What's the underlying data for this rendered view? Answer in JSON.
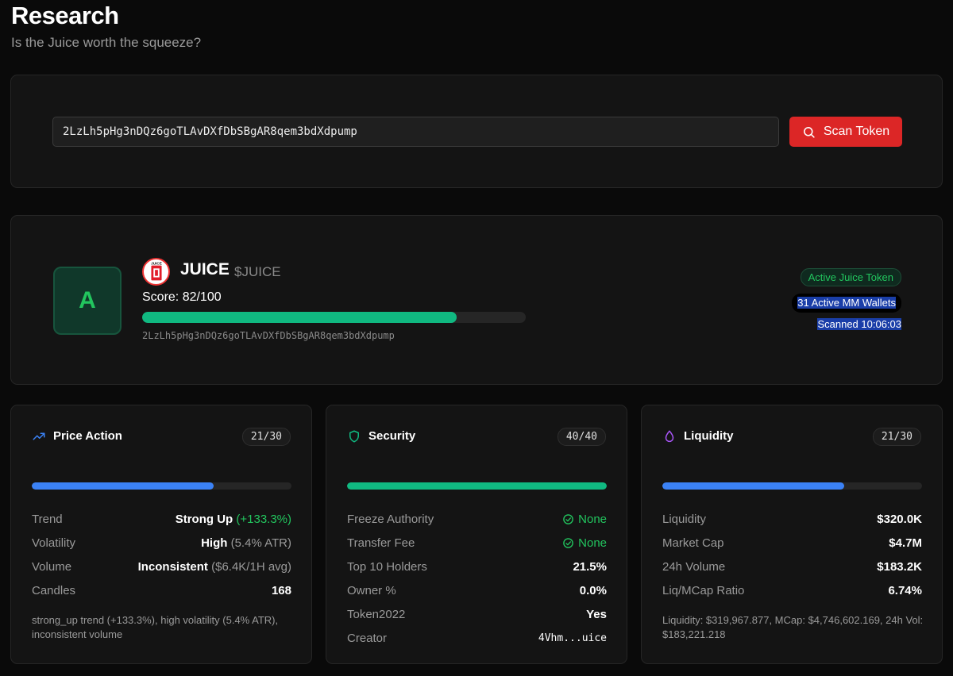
{
  "header": {
    "title": "Research",
    "subtitle": "Is the Juice worth the squeeze?"
  },
  "search": {
    "value": "2LzLh5pHg3nDQz6goTLAvDXfDbSBgAR8qem3bdXdpump",
    "button_label": "Scan Token",
    "button_icon": "search-icon",
    "button_color": "#dc2626"
  },
  "token": {
    "grade": "A",
    "name": "JUICE",
    "symbol": "$JUICE",
    "score_label": "Score: 82/100",
    "score": 82,
    "score_max": 100,
    "address": "2LzLh5pHg3nDQz6goTLAvDXfDbSBgAR8qem3bdXdpump",
    "logo_text": "JUICE",
    "badges": {
      "active": "Active Juice Token",
      "mm_wallets": "31 Active MM Wallets",
      "scanned": "Scanned 10:06:03"
    }
  },
  "price_action": {
    "title": "Price Action",
    "icon": "trending-up-icon",
    "score": "21/30",
    "fill": 0.7,
    "color": "#3b82f6",
    "rows": [
      {
        "label": "Trend",
        "value": "Strong Up",
        "detail": "(+133.3%)"
      },
      {
        "label": "Volatility",
        "value": "High",
        "detail": "(5.4% ATR)"
      },
      {
        "label": "Volume",
        "value": "Inconsistent",
        "detail": "($6.4K/1H avg)"
      },
      {
        "label": "Candles",
        "value": "168",
        "detail": ""
      }
    ],
    "note": "strong_up trend (+133.3%), high volatility (5.4% ATR), inconsistent volume"
  },
  "security": {
    "title": "Security",
    "icon": "shield-icon",
    "score": "40/40",
    "fill": 1.0,
    "color": "#10b981",
    "rows": [
      {
        "label": "Freeze Authority",
        "value": "None"
      },
      {
        "label": "Transfer Fee",
        "value": "None"
      },
      {
        "label": "Top 10 Holders",
        "value": "21.5%"
      },
      {
        "label": "Owner %",
        "value": "0.0%"
      },
      {
        "label": "Token2022",
        "value": "Yes"
      },
      {
        "label": "Creator",
        "value": "4Vhm...uice"
      }
    ]
  },
  "liquidity": {
    "title": "Liquidity",
    "icon": "droplet-icon",
    "score": "21/30",
    "fill": 0.7,
    "color": "#3b82f6",
    "rows": [
      {
        "label": "Liquidity",
        "value": "$320.0K"
      },
      {
        "label": "Market Cap",
        "value": "$4.7M"
      },
      {
        "label": "24h Volume",
        "value": "$183.2K"
      },
      {
        "label": "Liq/MCap Ratio",
        "value": "6.74%"
      }
    ],
    "note": "Liquidity: $319,967.877, MCap: $4,746,602.169, 24h Vol: $183,221.218"
  }
}
